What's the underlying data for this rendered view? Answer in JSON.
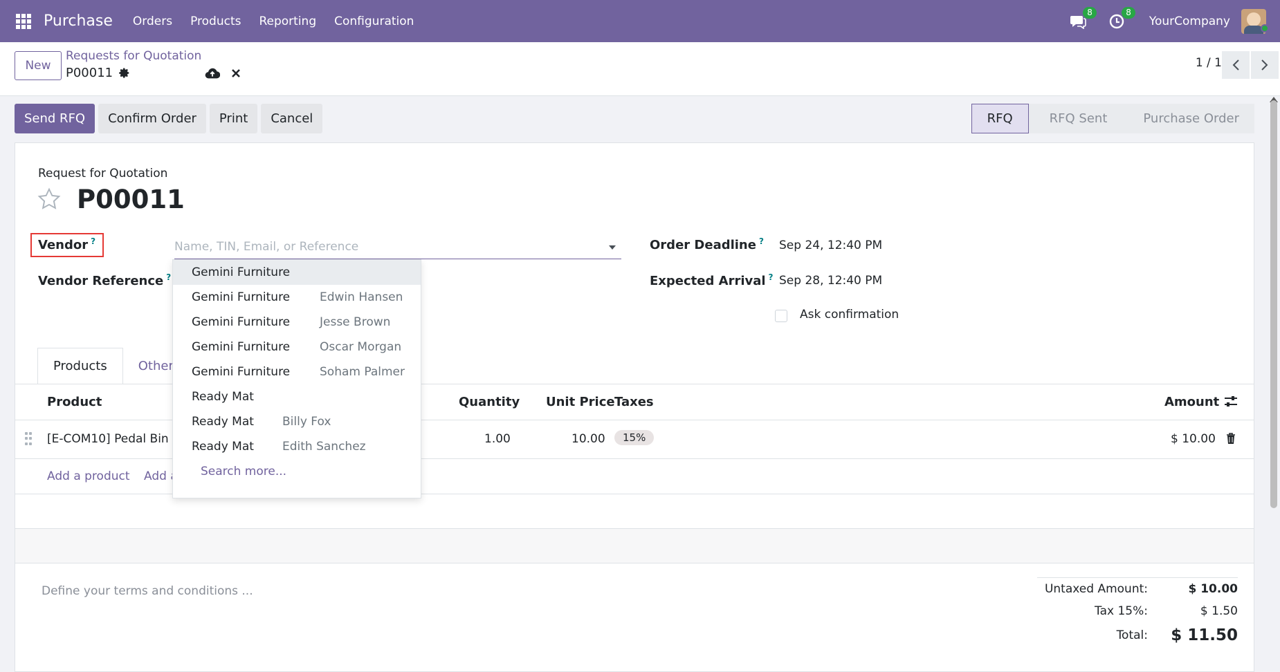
{
  "navbar": {
    "app_name": "Purchase",
    "menu": [
      "Orders",
      "Products",
      "Reporting",
      "Configuration"
    ],
    "messages_count": "8",
    "activities_count": "8",
    "company": "YourCompany"
  },
  "control_panel": {
    "new_label": "New",
    "breadcrumb_parent": "Requests for Quotation",
    "breadcrumb_current": "P00011",
    "pager": "1 / 1"
  },
  "statusbar": {
    "buttons": [
      "Send RFQ",
      "Confirm Order",
      "Print",
      "Cancel"
    ],
    "stages": [
      "RFQ",
      "RFQ Sent",
      "Purchase Order"
    ],
    "active_stage": "RFQ"
  },
  "form": {
    "label": "Request for Quotation",
    "title": "P00011",
    "vendor_label": "Vendor",
    "vendor_placeholder": "Name, TIN, Email, or Reference",
    "vendor_reference_label": "Vendor Reference",
    "order_deadline_label": "Order Deadline",
    "order_deadline_value": "Sep 24, 12:40 PM",
    "expected_arrival_label": "Expected Arrival",
    "expected_arrival_value": "Sep 28, 12:40 PM",
    "ask_confirmation_label": "Ask confirmation",
    "help_marker": "?"
  },
  "tabs": [
    "Products",
    "Other"
  ],
  "table": {
    "headers": {
      "product": "Product",
      "quantity": "Quantity",
      "unit_price": "Unit Price",
      "taxes": "Taxes",
      "amount": "Amount"
    },
    "rows": [
      {
        "product": "[E-COM10] Pedal Bin",
        "quantity": "1.00",
        "unit_price": "10.00",
        "taxes": "15%",
        "amount": "$ 10.00"
      }
    ],
    "add_product": "Add a product",
    "add_section": "Add a"
  },
  "terms_placeholder": "Define your terms and conditions ...",
  "totals": {
    "untaxed_label": "Untaxed Amount:",
    "untaxed_value": "$ 10.00",
    "tax_label": "Tax 15%:",
    "tax_value": "$ 1.50",
    "total_label": "Total:",
    "total_value": "$ 11.50"
  },
  "vendor_dropdown": {
    "items": [
      {
        "name": "Gemini Furniture",
        "contact": ""
      },
      {
        "name": "Gemini Furniture",
        "contact": "Edwin Hansen"
      },
      {
        "name": "Gemini Furniture",
        "contact": "Jesse Brown"
      },
      {
        "name": "Gemini Furniture",
        "contact": "Oscar Morgan"
      },
      {
        "name": "Gemini Furniture",
        "contact": "Soham Palmer"
      },
      {
        "name": "Ready Mat",
        "contact": ""
      },
      {
        "name": "Ready Mat",
        "contact": "Billy Fox"
      },
      {
        "name": "Ready Mat",
        "contact": "Edith Sanchez"
      }
    ],
    "search_more": "Search more..."
  },
  "colors": {
    "brand": "#71639e",
    "vendor_highlight_border": "#e53935",
    "badge": "#28a745"
  }
}
